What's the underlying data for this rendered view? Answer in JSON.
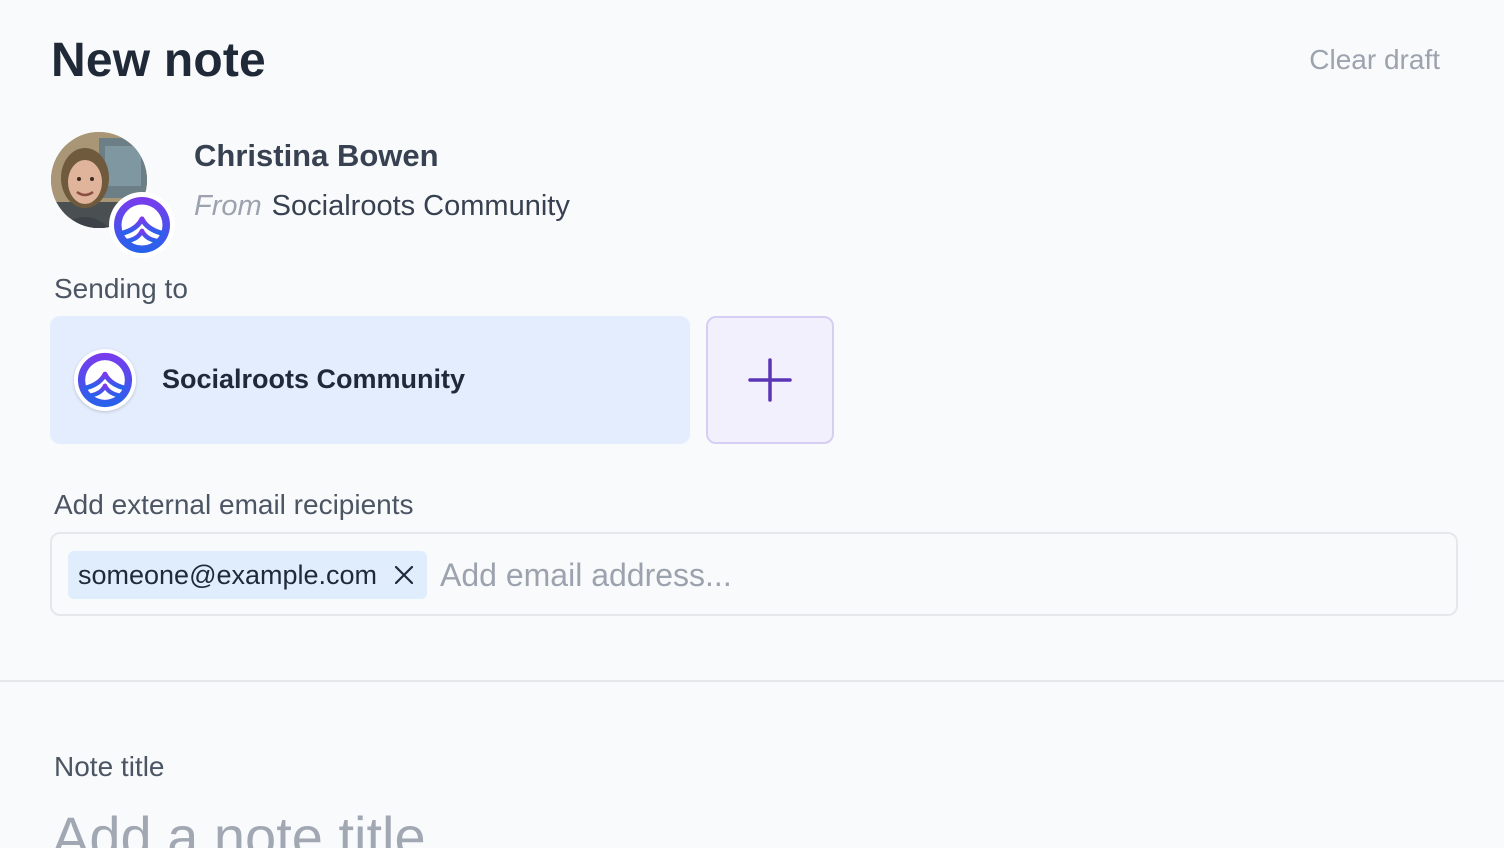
{
  "header": {
    "title": "New note",
    "clear_draft_label": "Clear draft"
  },
  "author": {
    "name": "Christina Bowen",
    "from_label": "From",
    "organization": "Socialroots Community"
  },
  "sending_to": {
    "label": "Sending to",
    "recipients": [
      {
        "name": "Socialroots Community",
        "icon": "socialroots-logo-icon"
      }
    ],
    "add_icon": "plus-icon"
  },
  "external_email": {
    "label": "Add external email recipients",
    "chips": [
      "someone@example.com"
    ],
    "remove_icon": "close-icon",
    "placeholder": "Add email address..."
  },
  "note": {
    "title_label": "Note title",
    "title_placeholder": "Add a note title"
  },
  "colors": {
    "brand_gradient_top": "#7c3aed",
    "brand_gradient_bottom": "#2563eb",
    "accent_purple": "#5b35b5",
    "recipient_card_bg": "#e3edfd",
    "chip_bg": "#e0edfc"
  }
}
